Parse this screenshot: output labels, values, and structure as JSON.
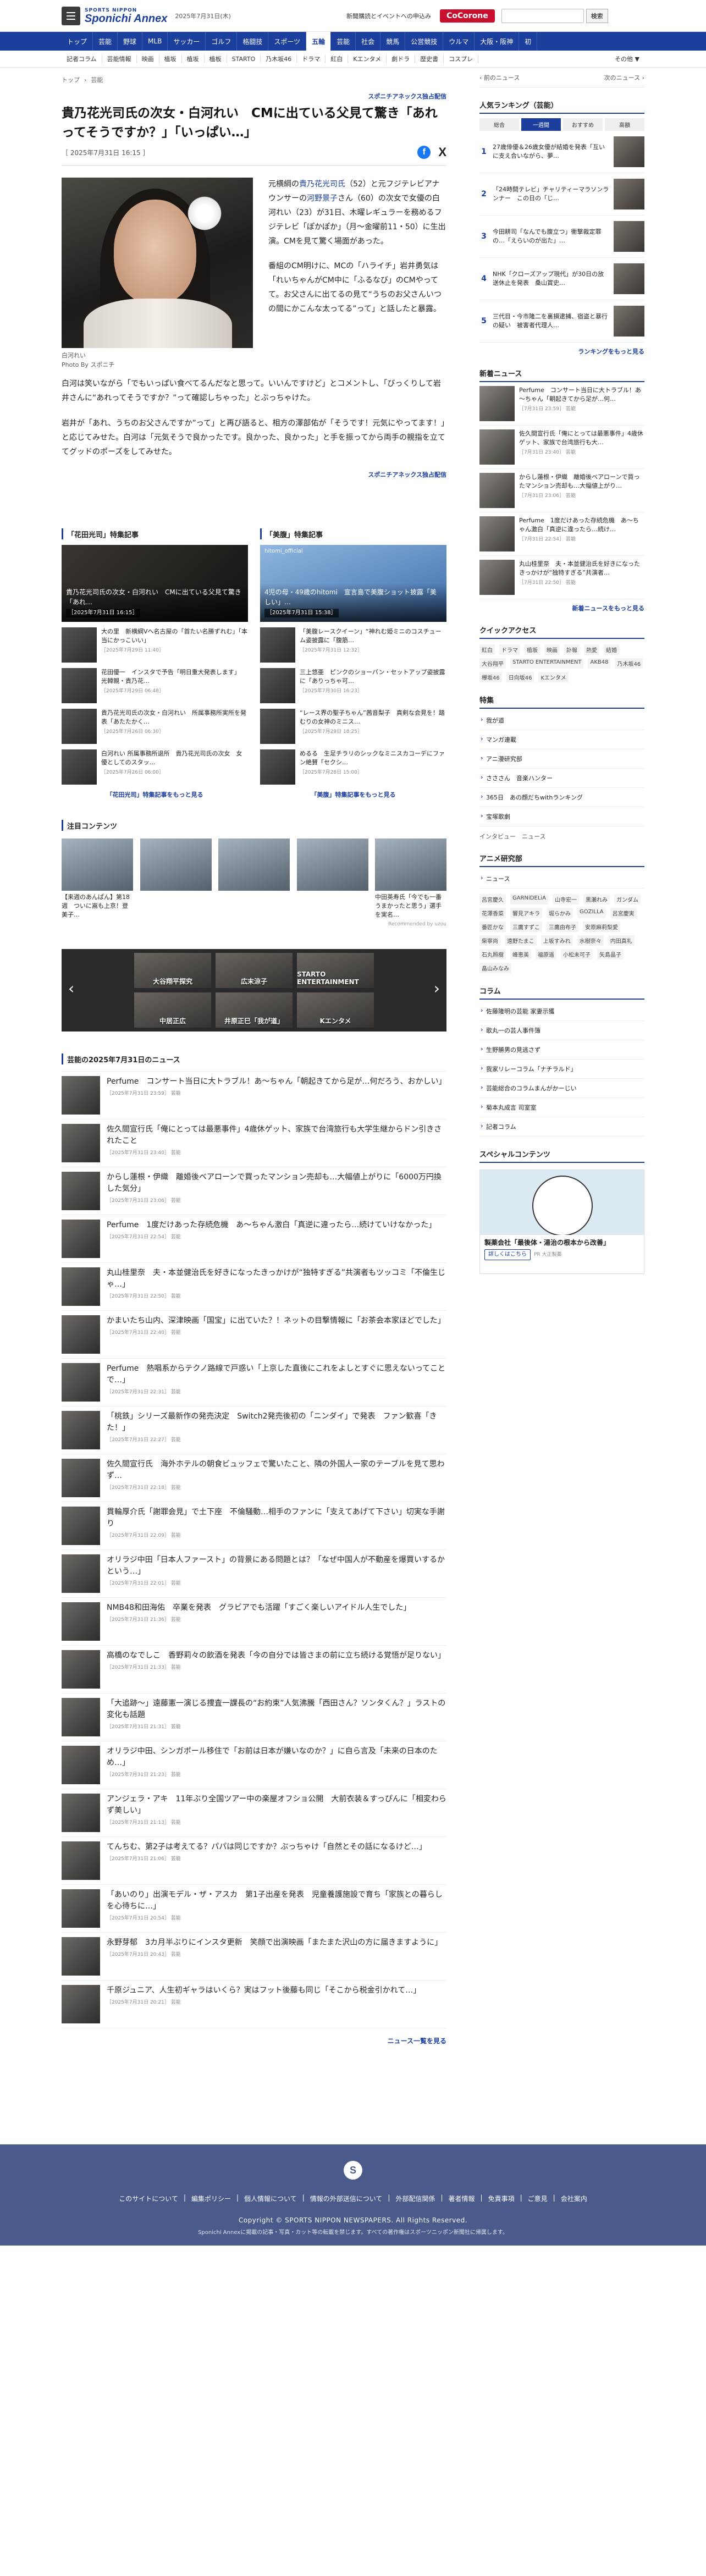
{
  "header": {
    "logo_top": "SPORTS NIPPON",
    "logo_main": "Sponichi Annex",
    "date": "2025年7月31日(木)",
    "notice": "新聞購読とイベントへの申込み",
    "promo": "CoCorone",
    "search_placeholder": "",
    "search_button": "検索"
  },
  "gnav": [
    "トップ",
    "芸能",
    "野球",
    "MLB",
    "サッカー",
    "ゴルフ",
    "格闘技",
    "スポーツ",
    "五輪",
    "芸能",
    "社会",
    "競馬",
    "公営競技",
    "ウルマ",
    "大阪・阪神",
    "初"
  ],
  "gnav_active": 8,
  "subnav": [
    "記者コラム",
    "芸能情報",
    "映画",
    "植坂",
    "植坂",
    "植板",
    "STARTO",
    "乃木坂46",
    "ドラマ",
    "紅白",
    "Kエンタメ",
    "劇ドラ",
    "歴史書",
    "コスプレ",
    "その他 ▼"
  ],
  "breadcrumb": [
    "トップ",
    "›",
    "芸能"
  ],
  "article": {
    "series": "スポニチアネックス独占配信",
    "title": "貴乃花光司氏の次女・白河れい　CMに出ている父見て驚き「あれってそうですか？」「いっぱい…」",
    "date": "［ 2025年7月31日 16:15 ］",
    "photo_caption": "白河れい",
    "photo_credit": "Photo By スポニチ",
    "p1a": "元横綱の",
    "p1link1": "貴乃花光司氏",
    "p1b": "（52）と元フジテレビアナウンサーの",
    "p1link2": "河野景子",
    "p1c": "さん（60）の次女で女優の白河れい（23）が31日、木曜レギュラーを務めるフジテレビ「ぽかぽか」（月～金曜前11・50）に生出演。CMを見て驚く場面があった。",
    "p2": "番組のCM明けに、MCの「ハライチ」岩井勇気は「れいちゃんがCM中に「ふるなび」のCMやってて。お父さんに出てるの見て“うちのお父さんいつの間にかこんな太ってる”って」と話したと暴露。",
    "p3": "白河は笑いながら「でもいっぱい食べてるんだなと思って。いいんですけど」とコメントし、「びっくりして岩井さんに“あれってそうですか？”って確認しちゃった」とぶっちゃけた。",
    "p4": "岩井が「あれ、うちのお父さんですか”って」と再び語ると、相方の澤部佑が「そうです！元気にやってます！」と応じてみせた。白河は「元気そうで良かったです。良かった、良かった」と手を振ってから両手の親指を立ててグッドのポーズをしてみせた。",
    "series_bottom": "スポニチアネックス独占配信"
  },
  "features": [
    {
      "title": "「花田光司」特集記事",
      "hero": "貴乃花光司氏の次女・白河れい　CMに出ている父見て驚き「あれ…",
      "hero_date": "［2025年7月31日 16:15］",
      "items": [
        {
          "t": "大の里　新横綱Vへ名古屋の「首たい名勝ずれむ」「本当にかっこいい」",
          "d": "［2025年7月29日 11:40］"
        },
        {
          "t": "花田優一　インスタで予告「明日重大発表します」　光韓親・貴乃花…",
          "d": "［2025年7月29日 06:48］"
        },
        {
          "t": "貴乃花光司氏の次女・白河れい　所属事務所実所を発表「あたたかく…",
          "d": "［2025年7月26日 06:30］"
        },
        {
          "t": "白河れい 所属事務所退所　貴乃花光司氏の次女　女優としてのスタッ…",
          "d": "［2025年7月26日 06:00］"
        }
      ],
      "more": "「花田光司」特集記事をもっと見る"
    },
    {
      "title": "「美腹」特集記事",
      "account": "hitomi_official",
      "hero": "4児の母・49歳のhitomi　宣言島で美腹ショット披露「美しい」…",
      "hero_date": "［2025年7月31日 15:38］",
      "items": [
        {
          "t": "「美腹レースクイーン」“神れむ姫ミニのコスチューム姿披露に「腹筋…",
          "d": "［2025年7月31日 12:32］"
        },
        {
          "t": "三上悠亜　ピンクのショーパン・セットアップ姿披露に「ありっちゃ可…",
          "d": "［2025年7月30日 16:23］"
        },
        {
          "t": "“レース界の聖子ちゃん”茜音梨子　真剣な会見を！踏むりの女神のミニス…",
          "d": "［2025年7月29日 18:25］"
        },
        {
          "t": "めるる　生足チラリのシックなミニスカコーデにファン絶賛「セクシ…",
          "d": "［2025年7月28日 15:00］"
        }
      ],
      "more": "「美腹」特集記事をもっと見る"
    }
  ],
  "recommended": {
    "title": "注目コンテンツ",
    "items": [
      {
        "t": "【来週のあんぱん】第18週　ついに嵩も上京！登美子…"
      },
      {
        "t": ""
      },
      {
        "t": ""
      },
      {
        "t": ""
      },
      {
        "t": "中田英寿氏「今でも一番うまかったと思う」選手を実名…"
      }
    ],
    "credit": "Recommended by uzou"
  },
  "carousel": [
    "大谷翔平探究",
    "広末涼子",
    "STARTO ENTERTAINMENT",
    "中居正広",
    "井原正巳「我が道」",
    "Kエンタメ"
  ],
  "news": {
    "title": "芸能の2025年7月31日のニュース",
    "items": [
      {
        "t": "Perfume　コンサート当日に大トラブル！あ～ちゃん「朝起きてから足が…何だろう、おかしい」",
        "d": "［2025年7月31日 23:59］ 芸能"
      },
      {
        "t": "佐久間宣行氏「俺にとっては最悪事件」4歳休ゲット、家族で台湾旅行も大学生継からドン引きされたこと",
        "d": "［2025年7月31日 23:40］ 芸能"
      },
      {
        "t": "からし蓮根・伊織　離婚後ベアローンで買ったマンション売却も…大幅値上がりに「6000万円換した気分」",
        "d": "［2025年7月31日 23:06］ 芸能"
      },
      {
        "t": "Perfume　1度だけあった存続危機　あ～ちゃん激白「真逆に違ったら…続けていけなかった」",
        "d": "［2025年7月31日 22:54］ 芸能"
      },
      {
        "t": "丸山桂里奈　夫・本並健治氏を好きになったきっかけが“独特すぎる”共演者もツッコミ「不倫生じゃ…」",
        "d": "［2025年7月31日 22:50］ 芸能"
      },
      {
        "t": "かまいたち山内、深津映画「国宝」に出ていた？！ネットの目撃情報に「お茶会本家ほどでした」",
        "d": "［2025年7月31日 22:40］ 芸能"
      },
      {
        "t": "Perfume　熱唱系からテクノ路線で戸惑い「上京した直後にこれをよしとすぐに思えないってことで…」",
        "d": "［2025年7月31日 22:31］ 芸能"
      },
      {
        "t": "「桃鉄」シリーズ最新作の発売決定　Switch2発売後初の「ニンダイ」で発表　ファン歓喜「きた！」",
        "d": "［2025年7月31日 22:27］ 芸能"
      },
      {
        "t": "佐久間宣行氏　海外ホテルの朝食ビュッフェで驚いたこと、隣の外国人一家のテーブルを見て思わず…",
        "d": "［2025年7月31日 22:18］ 芸能"
      },
      {
        "t": "貫輪厚介氏「謝罪会見」で土下座　不倫騒動…相手のファンに「支えてあげて下さい」切実な手謝り",
        "d": "［2025年7月31日 22:09］ 芸能"
      },
      {
        "t": "オリラジ中田「日本人ファースト」の背景にある問題とは？「なぜ中国人が不動産を爆買いするかという…」",
        "d": "［2025年7月31日 22:01］ 芸能"
      },
      {
        "t": "NMB48和田海佑　卒業を発表　グラビアでも活躍「すごく楽しいアイドル人生でした」",
        "d": "［2025年7月31日 21:36］ 芸能"
      },
      {
        "t": "高橋のなでしこ　香野莉々の飲酒を発表「今の自分では皆さまの前に立ち続ける覚悟が足りない」",
        "d": "［2025年7月31日 21:33］ 芸能"
      },
      {
        "t": "「大追跡～」遠藤憲一演じる捜査一課長の“お約束”人気沸騰「西田さん？ソンタくん？」ラストの変化も話題",
        "d": "［2025年7月31日 21:31］ 芸能"
      },
      {
        "t": "オリラジ中田、シンガポール移住で「お前は日本が嫌いなのか？」に自ら言及「未来の日本のため…」",
        "d": "［2025年7月31日 21:23］ 芸能"
      },
      {
        "t": "アンジェラ・アキ　11年ぶり全国ツアー中の楽屋オフショ公開　大前衣装＆すっぴんに「相変わらず美しい」",
        "d": "［2025年7月31日 21:13］ 芸能"
      },
      {
        "t": "てんちむ、第2子は考えてる？パパは同じですか？ぶっちゃけ「自然とその話になるけど…」",
        "d": "［2025年7月31日 21:06］ 芸能"
      },
      {
        "t": "「あいのり」出演モデル・ザ・アスカ　第1子出産を発表　児童養護施設で育ち「家族との暮らしを心待ちに…」",
        "d": "［2025年7月31日 20:54］ 芸能"
      },
      {
        "t": "永野芽郁　3カ月半ぶりにインスタ更新　笑顔で出演映画「またまた沢山の方に届きますように」",
        "d": "［2025年7月31日 20:43］ 芸能"
      },
      {
        "t": "千原ジュニア、人生初ギャラはいくら？実はフット後藤も同じ「そこから税金引かれて…」",
        "d": "［2025年7月31日 20:21］ 芸能"
      }
    ],
    "more": "ニュース一覧を見る"
  },
  "side": {
    "prev": "‹ 前のニュース",
    "next": "次のニュース ›",
    "ranking_title": "人気ランキング（芸能）",
    "ranking_tabs": [
      "総合",
      "一週間",
      "おすすめ",
      "高額"
    ],
    "ranking": [
      {
        "n": "1",
        "t": "27歳俳優＆26歳女優が結婚を発表「互いに支え合いながら、夢…"
      },
      {
        "n": "2",
        "t": "「24時間テレビ」チャリティーマラソンランナー　この日の「じ…"
      },
      {
        "n": "3",
        "t": "今田耕司「なんでも腹立つ」衝撃裁定罪の…「えらいのが出た」…"
      },
      {
        "n": "4",
        "t": "NHK「クローズアップ現代」が30日の放送休止を発表　桑山賞史…"
      },
      {
        "n": "5",
        "t": "三代目・今市隆二を裏損逮捕、宿盗と暴行の疑い　被害者代理人…"
      }
    ],
    "ranking_more": "ランキングをもっと見る",
    "new_title": "新着ニュース",
    "newnews": [
      {
        "t": "Perfume　コンサート当日に大トラブル！あ～ちゃん「朝起きてから足が…何…",
        "d": "［7月31日 23:59］ 芸能"
      },
      {
        "t": "佐久間宣行氏「俺にとっては最悪事件」4歳休ゲット、家族で台湾旅行も大…",
        "d": "［7月31日 23:40］ 芸能"
      },
      {
        "t": "からし蓮根・伊織　離婚後ベアローンで買ったマンション売却も…大幅値上がり…",
        "d": "［7月31日 23:06］ 芸能"
      },
      {
        "t": "Perfume　1度だけあった存続危機　あ～ちゃん激白「真逆に違ったら…続け…",
        "d": "［7月31日 22:54］ 芸能"
      },
      {
        "t": "丸山桂里奈　夫・本並健治氏を好きになったきっかけが“独特すぎる”共演者…",
        "d": "［7月31日 22:50］ 芸能"
      }
    ],
    "new_more": "新着ニュースをもっと見る",
    "quick_title": "クイックアクセス",
    "quick": [
      "紅白",
      "ドラマ",
      "植坂",
      "映画",
      "訃報",
      "熱愛",
      "結婚",
      "大谷翔平",
      "STARTO ENTERTAINMENT",
      "AKB48",
      "乃木坂46",
      "欅坂46",
      "日向坂46",
      "Kエンタメ"
    ],
    "feature_title": "特集",
    "features": [
      "我が道",
      "マンガ連載",
      "アニ漫研究部",
      "さささん　音楽ハンター",
      "365日　あの顔だちwithランキング",
      "宝塚歌劇"
    ],
    "feature_extra": "インタビュー　ニュース",
    "anime_title": "アニメ研究部",
    "anime_link": "ニュース",
    "anime_tags": [
      "呂宮慶久",
      "GARNiDELiA",
      "山寺宏一",
      "黒瀬れみ",
      "ガンダム",
      "花澤香菜",
      "響見アキラ",
      "堀らかみ",
      "GOZILLA",
      "呂宮慶実",
      "番匠かな",
      "三鷹すずこ",
      "三鷹由布子",
      "安原麻莉梨愛",
      "柴寧尚",
      "遠野たまこ",
      "上坂すみれ",
      "水樹奈々",
      "内田真礼",
      "石丸照樹",
      "峰恵美",
      "福原遥",
      "小松未可子",
      "矢島晶子",
      "畠山みなみ"
    ],
    "column_title": "コラム",
    "columns": [
      "佐藤隆明の芸能 家妻示獲",
      "歌丸一の芸人事件簿",
      "生野勝男の見逃さず",
      "我家リレーコラム「ナチラルド」",
      "芸能総合のコラムまんがかーじい",
      "菊本丸成言 司室室",
      "記者コラム"
    ],
    "special_title": "スペシャルコンテンツ",
    "ad": {
      "text": "製薬会社「最後体・湯治の根本から改善」",
      "btn": "詳しくはこちら",
      "sponsor": "PR 大正製薬"
    }
  },
  "footer": {
    "logo": "S",
    "links": [
      "このサイトについて",
      "編集ポリシー",
      "個人情報について",
      "情報の外部送信について",
      "外部配信関係",
      "著者情報",
      "免責事項",
      "ご意見",
      "会社案内"
    ],
    "copy": "Copyright © SPORTS NIPPON NEWSPAPERS. All Rights Reserved.",
    "note": "Sponichi Annexに掲載の記事・写真・カット等の転載を禁じます。すべての著作権はスポーツニッポン新聞社に帰属します。"
  }
}
